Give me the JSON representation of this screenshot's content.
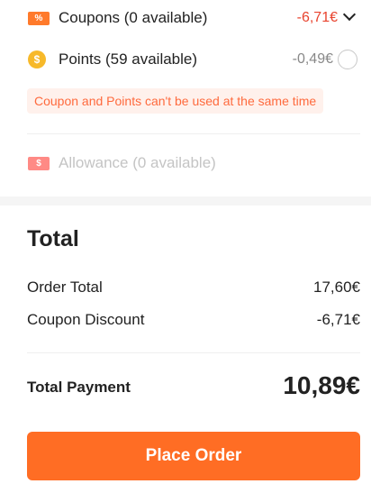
{
  "discounts": {
    "coupons": {
      "icon": "percent-coupon-icon",
      "icon_glyph": "%",
      "label": "Coupons (0 available)",
      "value": "-6,71€",
      "value_color": "#e8432e",
      "action_icon": "chevron-down-icon"
    },
    "points": {
      "icon": "coin-icon",
      "icon_glyph": "$",
      "label": "Points (59 available)",
      "value": "-0,49€",
      "value_color": "#888888",
      "checked": false
    },
    "warning": "Coupon and Points can't be used at the same time",
    "allowance": {
      "icon": "allowance-coupon-icon",
      "icon_glyph": "$",
      "label": "Allowance (0 available)"
    }
  },
  "total": {
    "title": "Total",
    "rows": [
      {
        "label": "Order Total",
        "value": "17,60€"
      },
      {
        "label": "Coupon Discount",
        "value": "-6,71€"
      }
    ],
    "payment_label": "Total Payment",
    "payment_value": "10,89€"
  },
  "actions": {
    "place_order": "Place Order"
  },
  "colors": {
    "accent": "#ff6d24",
    "discount_red": "#e8432e",
    "warning_text": "#ff6a3d",
    "warning_bg": "#fff1ec"
  }
}
